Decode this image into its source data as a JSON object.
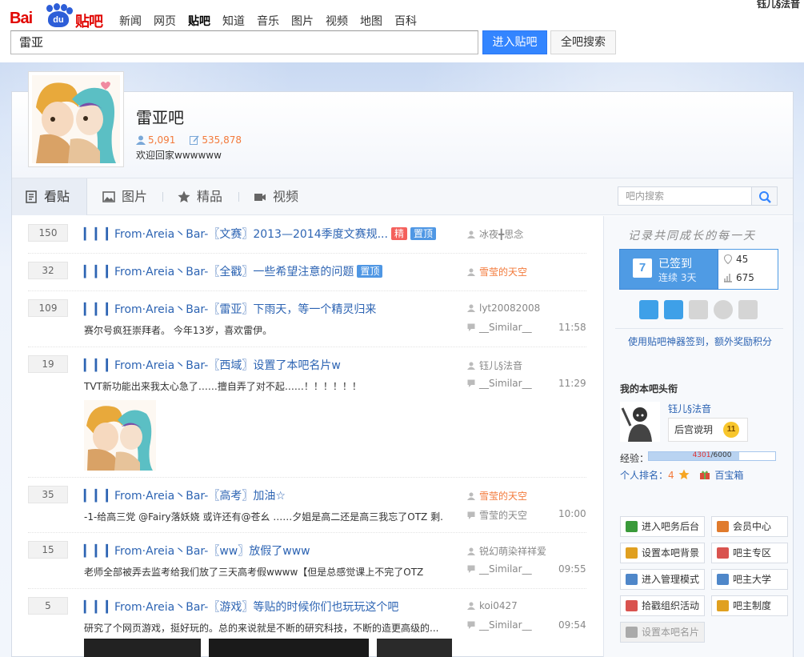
{
  "logo": {
    "brand": "Bai",
    "paw_text": "du",
    "product": "贴吧"
  },
  "nav": [
    "新闻",
    "网页",
    "贴吧",
    "知道",
    "音乐",
    "图片",
    "视频",
    "地图",
    "百科"
  ],
  "nav_active": 2,
  "top_user": "钰儿§法音",
  "search": {
    "value": "雷亚",
    "enter_label": "进入贴吧",
    "all_label": "全吧搜索"
  },
  "forum": {
    "name": "雷亚吧",
    "members": "5,091",
    "posts": "535,878",
    "slogan": "欢迎回家wwwwww"
  },
  "tabs": [
    {
      "label": "看贴",
      "icon": "document-icon"
    },
    {
      "label": "图片",
      "icon": "image-icon"
    },
    {
      "label": "精品",
      "icon": "star-icon"
    },
    {
      "label": "视频",
      "icon": "video-icon"
    }
  ],
  "inner_search": {
    "placeholder": "吧内搜索"
  },
  "threads": [
    {
      "replies": "150",
      "title": "From·Areia丶Bar-〖文赛〗2013—2014季度文赛规...",
      "tags": [
        "精",
        "置顶"
      ],
      "author": "冰夜╋思念",
      "author_orange": false,
      "abstract": "",
      "last": "",
      "time": ""
    },
    {
      "replies": "32",
      "title": "From·Areia丶Bar-〖全戳〗一些希望注意的问题",
      "tags": [
        "置顶"
      ],
      "author": "雪莹的天空",
      "author_orange": true,
      "abstract": "",
      "last": "",
      "time": ""
    },
    {
      "replies": "109",
      "title": "From·Areia丶Bar-〖雷亚〗下雨天，等一个精灵归来",
      "tags": [],
      "author": "lyt20082008",
      "author_orange": false,
      "abstract": "赛尔号疯狂崇拜者。 今年13岁，喜欢雷伊。",
      "last": "__Similar__",
      "time": "11:58"
    },
    {
      "replies": "19",
      "title": "From·Areia丶Bar-〖西域〗设置了本吧名片w",
      "tags": [],
      "author": "钰儿§法音",
      "author_orange": false,
      "abstract": "TVT新功能出来我太心急了……擅自弄了对不起……！！！！！！",
      "last": "__Similar__",
      "time": "11:29"
    },
    {
      "replies": "35",
      "title": "From·Areia丶Bar-〖高考〗加油☆",
      "tags": [],
      "author": "雪莹的天空",
      "author_orange": true,
      "abstract": "-1-给高三党 @Fairy落妖娆 或许还有@苍幺 ……夕姐是高二还是高三我忘了OTZ 剩...",
      "last": "雪莹的天空",
      "time": "10:00"
    },
    {
      "replies": "15",
      "title": "From·Areia丶Bar-〖ww〗放假了www",
      "tags": [],
      "author": "锐幻萌染祥祥爱",
      "author_orange": false,
      "abstract": "老师全部被弄去监考给我们放了三天高考假wwww【但是总感觉课上不完了OTZ",
      "last": "__Similar__",
      "time": "09:55"
    },
    {
      "replies": "5",
      "title": "From·Areia丶Bar-〖游戏〗等贴的时候你们也玩玩这个吧",
      "tags": [],
      "author": "koi0427",
      "author_orange": false,
      "abstract": "研究了个网页游戏，挺好玩的。总的来说就是不断的研究科技，不断的造更高级的...",
      "last": "__Similar__",
      "time": "09:54"
    }
  ],
  "sign": {
    "slogan": "记录共同成长的每一天",
    "calendar_day": "7",
    "status": "已签到",
    "days": "连续 3天",
    "rank": "45",
    "total": "675",
    "tip": "使用贴吧神器签到，额外奖励积分"
  },
  "my": {
    "heading": "我的本吧头衔",
    "name": "钰儿§法音",
    "title": "后宫谠玥",
    "level": "11",
    "exp_label": "经验：",
    "exp_current": "4301",
    "exp_max": "/6000",
    "exp_fraction": 0.717,
    "rank_label": "个人排名：",
    "rank_num": "4",
    "treasure": "百宝箱"
  },
  "tools": [
    {
      "label": "进入吧务后台",
      "color": "#3a9a3a"
    },
    {
      "label": "会员中心",
      "color": "#e07b2d"
    },
    {
      "label": "设置本吧背景",
      "color": "#e0a020"
    },
    {
      "label": "吧主专区",
      "color": "#d9534f"
    },
    {
      "label": "进入管理模式",
      "color": "#4f87c9"
    },
    {
      "label": "吧主大学",
      "color": "#4f87c9"
    },
    {
      "label": "拾戳组织活动",
      "color": "#d9534f"
    },
    {
      "label": "吧主制度",
      "color": "#e0a020"
    },
    {
      "label": "设置本吧名片",
      "color": "#aaaaaa"
    }
  ],
  "colors": {
    "accent_blue": "#3385ff",
    "link": "#2d64b3",
    "orange": "#f37a3b",
    "brand_red": "#e10602"
  }
}
